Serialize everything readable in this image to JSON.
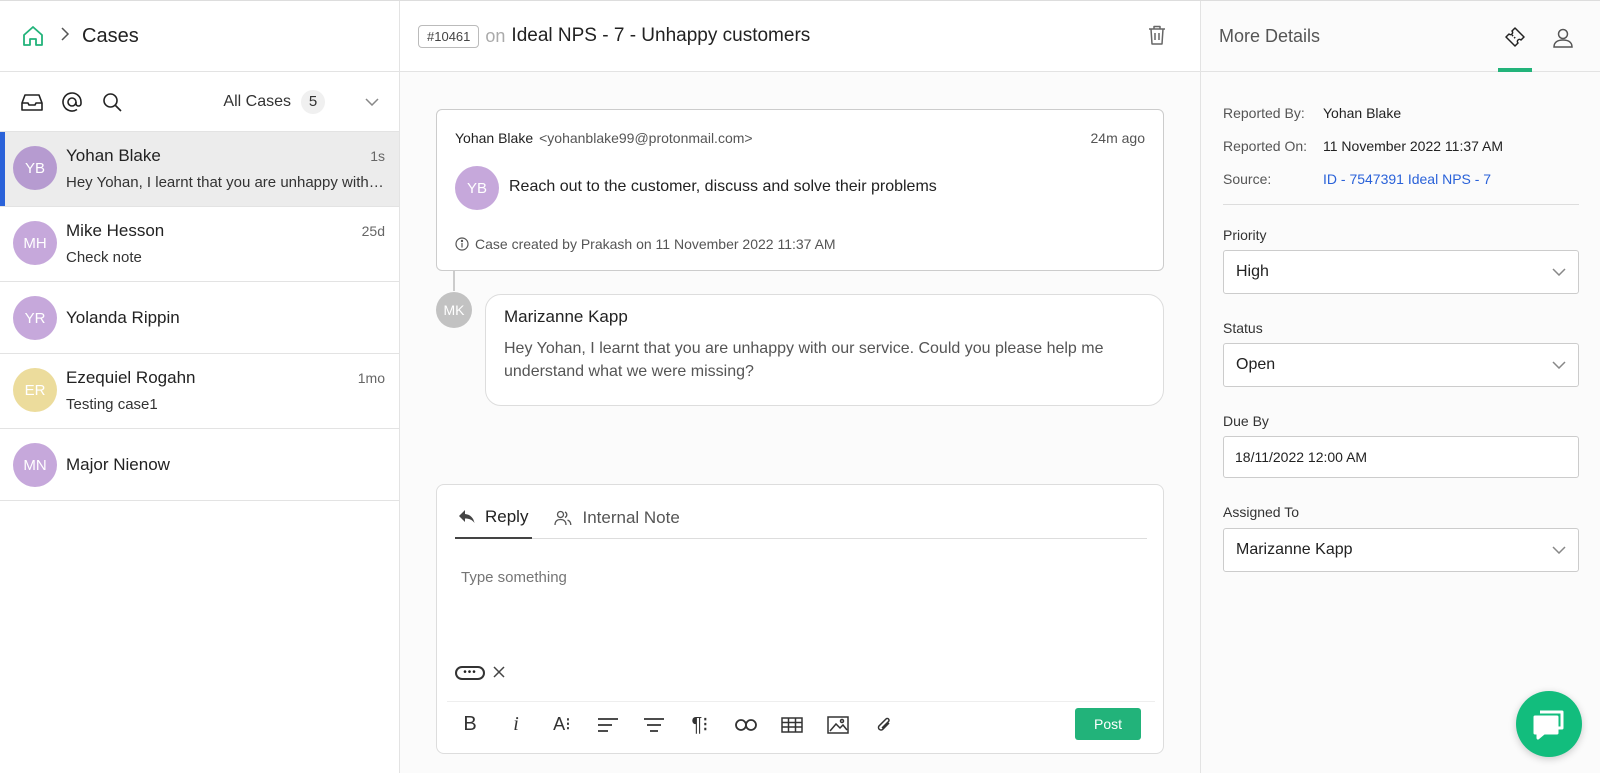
{
  "left": {
    "title": "Cases",
    "filter_label": "All Cases",
    "filter_count": "5",
    "cases": [
      {
        "initials": "YB",
        "name": "Yohan Blake",
        "time": "1s",
        "preview": "Hey Yohan, I learnt that you are unhappy with our service. Could you please help me",
        "color": "#b69bd0",
        "active": true
      },
      {
        "initials": "MH",
        "name": "Mike Hesson",
        "time": "25d",
        "preview": "Check note",
        "color": "#c6a8db"
      },
      {
        "initials": "YR",
        "name": "Yolanda Rippin",
        "time": "",
        "preview": "",
        "color": "#c6a8db"
      },
      {
        "initials": "ER",
        "name": "Ezequiel Rogahn",
        "time": "1mo",
        "preview": "Testing case1",
        "color": "#ecdc9c"
      },
      {
        "initials": "MN",
        "name": "Major Nienow",
        "time": "",
        "preview": "",
        "color": "#c6a8db"
      }
    ]
  },
  "center": {
    "case_id": "#10461",
    "on_word": "on",
    "title": "Ideal NPS - 7 - Unhappy customers",
    "message": {
      "from_name": "Yohan Blake",
      "from_email": "<yohanblake99@protonmail.com>",
      "time": "24m ago",
      "avatar_initials": "YB",
      "text": "Reach out to the customer, discuss and solve their problems",
      "footer": "Case created by Prakash on 11 November 2022 11:37 AM"
    },
    "reply": {
      "avatar_initials": "MK",
      "name": "Marizanne Kapp",
      "text": "Hey Yohan, I learnt that you are unhappy with our service. Could you please help me understand what we were missing?"
    },
    "composer": {
      "tab_reply": "Reply",
      "tab_note": "Internal Note",
      "placeholder": "Type something",
      "post_label": "Post"
    }
  },
  "right": {
    "title": "More Details",
    "reported_by_label": "Reported By:",
    "reported_by": "Yohan Blake",
    "reported_on_label": "Reported On:",
    "reported_on": "11 November 2022 11:37 AM",
    "source_label": "Source:",
    "source": "ID - 7547391 Ideal NPS - 7",
    "priority_label": "Priority",
    "priority": "High",
    "status_label": "Status",
    "status": "Open",
    "due_label": "Due By",
    "due": "18/11/2022 12:00 AM",
    "assigned_label": "Assigned To",
    "assigned": "Marizanne Kapp"
  },
  "colors": {
    "accent_green": "#22b37a",
    "active_blue": "#2a62d9"
  }
}
